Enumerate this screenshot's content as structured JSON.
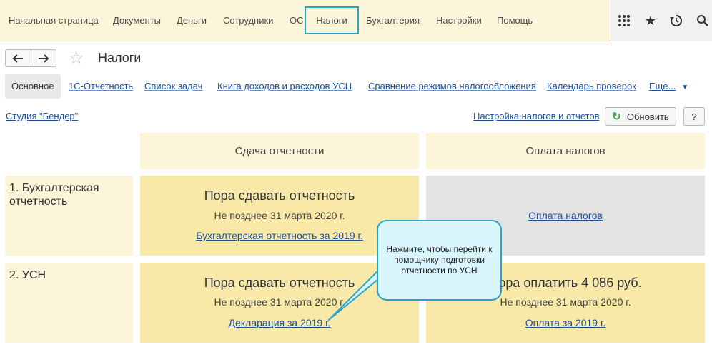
{
  "menu": {
    "items": [
      {
        "label": "Начальная страница"
      },
      {
        "label": "Документы"
      },
      {
        "label": "Деньги"
      },
      {
        "label": "Сотрудники"
      },
      {
        "label": "ОС"
      },
      {
        "label": "Налоги"
      },
      {
        "label": "Бухгалтерия"
      },
      {
        "label": "Настройки"
      },
      {
        "label": "Помощь"
      }
    ],
    "active": "Налоги"
  },
  "page": {
    "title": "Налоги"
  },
  "tabs": [
    {
      "label": "Основное"
    },
    {
      "label": "1С-Отчетность"
    },
    {
      "label": "Список задач"
    },
    {
      "label": "Книга доходов и расходов УСН"
    },
    {
      "label": "Сравнение режимов налогообложения"
    },
    {
      "label": "Календарь проверок"
    },
    {
      "label": "Еще..."
    }
  ],
  "toolbar": {
    "organization": "Студия \"Бендер\"",
    "settings_link": "Настройка налогов и отчетов",
    "refresh_label": "Обновить",
    "help_label": "?"
  },
  "grid": {
    "col_headers": [
      "Сдача отчетности",
      "Оплата налогов"
    ],
    "rows": [
      {
        "label": "1. Бухгалтерская отчетность",
        "report": {
          "title": "Пора сдавать отчетность",
          "deadline": "Не позднее 31 марта 2020 г.",
          "link": "Бухгалтерская отчетность за 2019 г."
        },
        "payment": {
          "link": "Оплата налогов"
        }
      },
      {
        "label": "2. УСН",
        "report": {
          "title": "Пора сдавать отчетность",
          "deadline": "Не позднее 31 марта 2020 г.",
          "link": "Декларация за 2019 г."
        },
        "payment": {
          "title": "Пора оплатить 4 086 руб.",
          "deadline": "Не позднее 31 марта 2020 г.",
          "link": "Оплата за 2019 г."
        }
      }
    ]
  },
  "callout": {
    "text": "Нажмите, чтобы перейти к помощнику подготовки отчетности по УСН"
  },
  "colors": {
    "accent": "#2aa2c6",
    "link": "#1e4f95",
    "card": "#f8e9a8",
    "header_bg": "#fcf5d9"
  }
}
